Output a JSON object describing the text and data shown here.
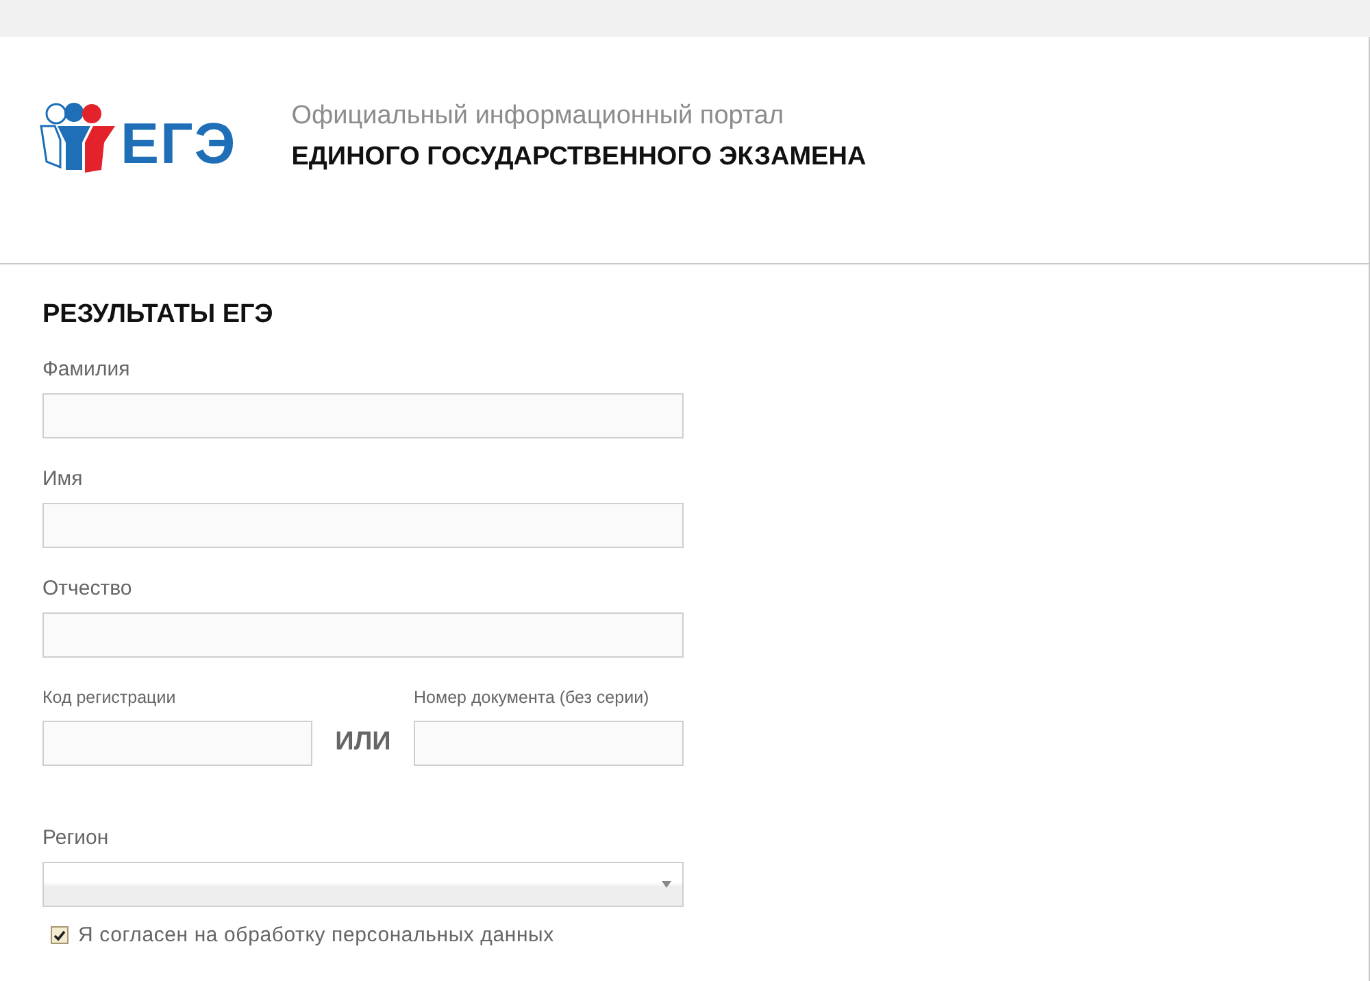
{
  "header": {
    "logo_text": "ЕГЭ",
    "subtitle": "Официальный информационный портал",
    "title": "ЕДИНОГО ГОСУДАРСТВЕННОГО ЭКЗАМЕНА"
  },
  "form": {
    "heading": "РЕЗУЛЬТАТЫ ЕГЭ",
    "fields": [
      {
        "label": "Фамилия"
      },
      {
        "label": "Имя"
      },
      {
        "label": "Отчество"
      }
    ],
    "id_row": {
      "left_label": "Код регистрации",
      "separator": "ИЛИ",
      "right_label": "Номер документа (без серии)"
    },
    "region": {
      "label": "Регион"
    },
    "consent": {
      "label": "Я согласен на обработку персональных данных",
      "checked": true
    }
  }
}
